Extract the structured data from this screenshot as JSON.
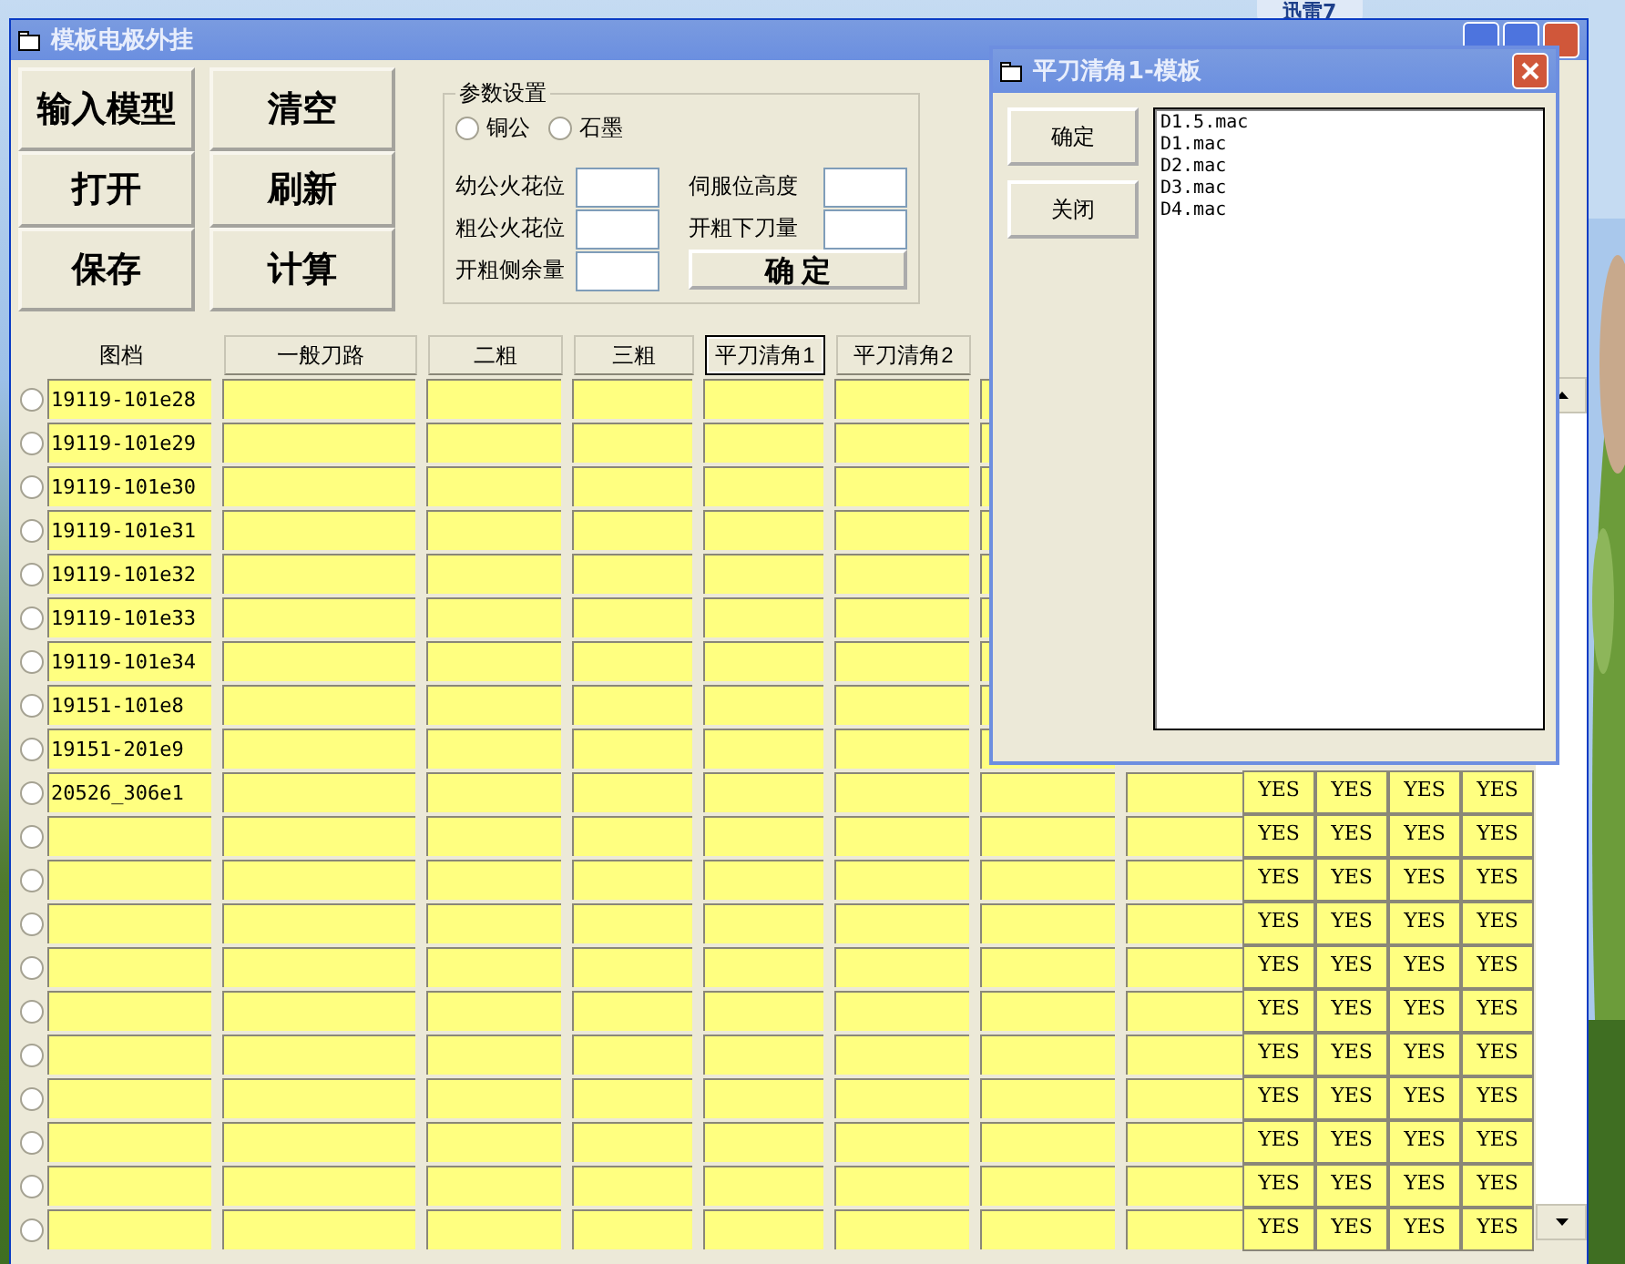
{
  "desktop_widget": {
    "label": "迅雷7"
  },
  "window": {
    "title": "模板电极外挂"
  },
  "actions": [
    {
      "label": "输入模型"
    },
    {
      "label": "清空"
    },
    {
      "label": "打开"
    },
    {
      "label": "刷新"
    },
    {
      "label": "保存"
    },
    {
      "label": "计算"
    }
  ],
  "params": {
    "title": "参数设置",
    "materials": [
      {
        "label": "铜公",
        "checked": false
      },
      {
        "label": "石墨",
        "checked": false
      }
    ],
    "fields": [
      {
        "label": "幼公火花位"
      },
      {
        "label": "伺服位高度"
      },
      {
        "label": "粗公火花位"
      },
      {
        "label": "开粗下刀量"
      },
      {
        "label": "开粗侧余量"
      }
    ],
    "confirm": "确 定"
  },
  "table": {
    "name_header": "图档",
    "columns": [
      {
        "label": "一般刀路",
        "selected": false
      },
      {
        "label": "二粗",
        "selected": false
      },
      {
        "label": "三粗",
        "selected": false
      },
      {
        "label": "平刀清角1",
        "selected": true
      },
      {
        "label": "平刀清角2",
        "selected": false
      }
    ],
    "rows": [
      {
        "name": "19119-101e28",
        "selected": false
      },
      {
        "name": "19119-101e29",
        "selected": false
      },
      {
        "name": "19119-101e30",
        "selected": false
      },
      {
        "name": "19119-101e31",
        "selected": false
      },
      {
        "name": "19119-101e32",
        "selected": false
      },
      {
        "name": "19119-101e33",
        "selected": false
      },
      {
        "name": "19119-101e34",
        "selected": false
      },
      {
        "name": "19151-101e8",
        "selected": false
      },
      {
        "name": "19151-201e9",
        "selected": false
      },
      {
        "name": "20526_306e1",
        "selected": false,
        "flags": [
          "YES",
          "YES",
          "YES",
          "YES"
        ]
      },
      {
        "selected": false,
        "flags": [
          "YES",
          "YES",
          "YES",
          "YES"
        ]
      },
      {
        "selected": false,
        "flags": [
          "YES",
          "YES",
          "YES",
          "YES"
        ]
      },
      {
        "selected": false,
        "flags": [
          "YES",
          "YES",
          "YES",
          "YES"
        ]
      },
      {
        "selected": false,
        "flags": [
          "YES",
          "YES",
          "YES",
          "YES"
        ]
      },
      {
        "selected": false,
        "flags": [
          "YES",
          "YES",
          "YES",
          "YES"
        ]
      },
      {
        "selected": false,
        "flags": [
          "YES",
          "YES",
          "YES",
          "YES"
        ]
      },
      {
        "selected": false,
        "flags": [
          "YES",
          "YES",
          "YES",
          "YES"
        ]
      },
      {
        "selected": false,
        "flags": [
          "YES",
          "YES",
          "YES",
          "YES"
        ]
      },
      {
        "selected": false,
        "flags": [
          "YES",
          "YES",
          "YES",
          "YES"
        ]
      },
      {
        "selected": false,
        "flags": [
          "YES",
          "YES",
          "YES",
          "YES"
        ]
      }
    ]
  },
  "dialog": {
    "title": "平刀清角1-模板",
    "buttons": [
      "确定",
      "关闭"
    ],
    "files": [
      "D1.5.mac",
      "D1.mac",
      "D2.mac",
      "D3.mac",
      "D4.mac"
    ]
  }
}
